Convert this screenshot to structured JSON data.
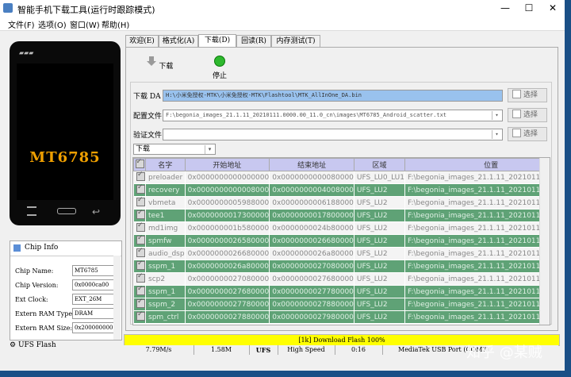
{
  "window": {
    "title": "智能手机下载工具(运行时跟踪模式)",
    "controls": [
      "—",
      "☐",
      "✕"
    ]
  },
  "menu": [
    "文件(F)",
    "选项(O)",
    "窗口(W)",
    "帮助(H)"
  ],
  "phone": {
    "chip": "MT6785"
  },
  "chip_info": {
    "title": "Chip Info",
    "fields": [
      {
        "label": "Chip Name:",
        "value": "MT6785"
      },
      {
        "label": "Chip Version:",
        "value": "0x0000ca00"
      },
      {
        "label": "Ext Clock:",
        "value": "EXT_26M"
      },
      {
        "label": "Extern RAM Type:",
        "value": "DRAM"
      },
      {
        "label": "Extern RAM Size:",
        "value": "0x200000000"
      }
    ]
  },
  "ufs_flash_label": "UFS Flash",
  "tabs": [
    "欢迎(E)",
    "格式化(A)",
    "下载(D)",
    "回读(R)",
    "内存测试(T)"
  ],
  "active_tab": 2,
  "toolbar": {
    "download": "下载",
    "stop": "停止"
  },
  "files": {
    "download_agent": {
      "label": "下载 DA",
      "path": "H:\\小米免授权-MTK\\小米免授权-MTK\\Flashtool\\MTK_AllInOne_DA.bin",
      "select": "选择"
    },
    "scatter": {
      "label": "配置文件",
      "path": "F:\\begonia_images_21.1.11_20210111.0000.00_11.0_cn\\images\\MT6785_Android_scatter.txt",
      "select": "选择"
    },
    "auth": {
      "label": "验证文件",
      "path": "",
      "select": "选择"
    }
  },
  "mode_select": "下载",
  "table": {
    "headers": [
      "",
      "名字",
      "开始地址",
      "结束地址",
      "区域",
      "位置"
    ],
    "rows": [
      {
        "style": "w",
        "name": "preloader",
        "start": "0x0000000000000000",
        "end": "0x0000000000080000",
        "region": "UFS_LU0_LU1",
        "loc": "F:\\begonia_images_21.1.11_20210111.0000.00"
      },
      {
        "style": "g",
        "name": "recovery",
        "start": "0x0000000000008000",
        "end": "0x0000000004008000",
        "region": "UFS_LU2",
        "loc": "F:\\begonia_images_21.1.11_20210111.0000.00"
      },
      {
        "style": "w",
        "name": "vbmeta",
        "start": "0x0000000005988000",
        "end": "0x0000000006188000",
        "region": "UFS_LU2",
        "loc": "F:\\begonia_images_21.1.11_20210111.0000.00"
      },
      {
        "style": "g",
        "name": "tee1",
        "start": "0x0000000017300000",
        "end": "0x0000000017800000",
        "region": "UFS_LU2",
        "loc": "F:\\begonia_images_21.1.11_20210111.0000.00"
      },
      {
        "style": "w",
        "name": "md1img",
        "start": "0x000000001b580000",
        "end": "0x0000000024b80000",
        "region": "UFS_LU2",
        "loc": "F:\\begonia_images_21.1.11_20210111.0000.00"
      },
      {
        "style": "g",
        "name": "spmfw",
        "start": "0x0000000026580000",
        "end": "0x0000000026680000",
        "region": "UFS_LU2",
        "loc": "F:\\begonia_images_21.1.11_20210111.0000.00"
      },
      {
        "style": "w",
        "name": "audio_dsp",
        "start": "0x0000000026680000",
        "end": "0x0000000026a80000",
        "region": "UFS_LU2",
        "loc": "F:\\begonia_images_21.1.11_20210111.0000.00"
      },
      {
        "style": "g",
        "name": "sspm_1",
        "start": "0x0000000026a80000",
        "end": "0x0000000027080000",
        "region": "UFS_LU2",
        "loc": "F:\\begonia_images_21.1.11_20210111.0000.00"
      },
      {
        "style": "w",
        "name": "scp2",
        "start": "0x0000000027080000",
        "end": "0x0000000027680000",
        "region": "UFS_LU2",
        "loc": "F:\\begonia_images_21.1.11_20210111.0000.00"
      },
      {
        "style": "g",
        "name": "sspm_1",
        "start": "0x0000000027680000",
        "end": "0x0000000027780000",
        "region": "UFS_LU2",
        "loc": "F:\\begonia_images_21.1.11_20210111.0000.00"
      },
      {
        "style": "g",
        "name": "sspm_2",
        "start": "0x0000000027780000",
        "end": "0x0000000027880000",
        "region": "UFS_LU2",
        "loc": "F:\\begonia_images_21.1.11_20210111.0000.00"
      },
      {
        "style": "g",
        "name": "spm_ctrl",
        "start": "0x0000000027880000",
        "end": "0x0000000027980000",
        "region": "UFS_LU2",
        "loc": "F:\\begonia_images_21.1.11_20210111.0000.00"
      }
    ]
  },
  "progress_text": "[1k] Download Flash 100%",
  "status": {
    "speed": "7.79M/s",
    "size": "1.58M",
    "storage": "UFS",
    "mode": "High Speed",
    "time": "0:16",
    "port": "MediaTek USB Port (COM7)"
  },
  "watermark": "知乎 @某贼"
}
